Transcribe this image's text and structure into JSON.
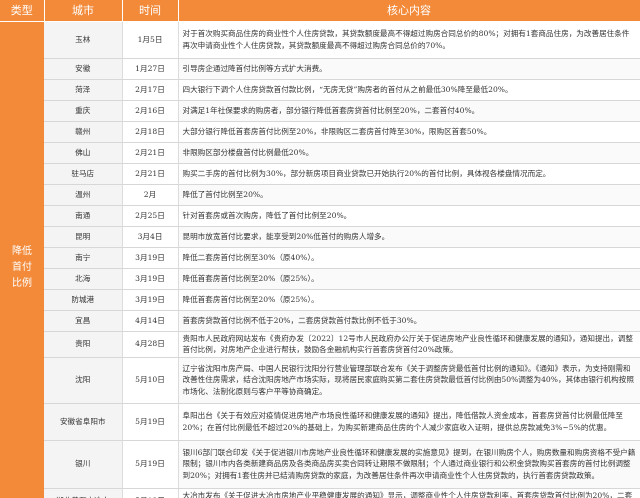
{
  "headers": [
    "类型",
    "城市",
    "时间",
    "核心内容"
  ],
  "type_label": "降低首付比例",
  "rows": [
    {
      "city": "玉林",
      "date": "1月5日",
      "content": "对于首次购买商品住房的商业性个人住房贷款，其贷款额度最高不得超过购房合同总价的80%；对拥有1套商品住房，为改善居住条件再次申请商业性个人住房贷款，其贷款额度最高不得超过购房合同总价的70%。"
    },
    {
      "city": "安徽",
      "date": "1月27日",
      "content": "引导房企通过降首付比例等方式扩大消费。"
    },
    {
      "city": "菏泽",
      "date": "2月17日",
      "content": "四大银行下调个人住房贷款首付款比例，“无房无贷”购房者的首付从之前最低30%降至最低20%。"
    },
    {
      "city": "重庆",
      "date": "2月16日",
      "content": "对满足1年社保要求的购房者，部分银行降低首套房贷首付比例至20%，二套首付40%。"
    },
    {
      "city": "赣州",
      "date": "2月18日",
      "content": "大部分银行降低首套房首付比例至20%，非限购区二套房首付降至30%，限购区首套50%。"
    },
    {
      "city": "佛山",
      "date": "2月21日",
      "content": "非限购区部分楼盘首付比例最低20%。"
    },
    {
      "city": "驻马店",
      "date": "2月21日",
      "content": "购买二手房的首付比例为30%，部分新房项目商业贷款已开始执行20%的首付比例，具体视各楼盘情况而定。"
    },
    {
      "city": "温州",
      "date": "2月",
      "content": "降低了首付比例至20%。"
    },
    {
      "city": "南通",
      "date": "2月25日",
      "content": "针对首套房或首次购房，降低了首付比例至20%。"
    },
    {
      "city": "昆明",
      "date": "3月4日",
      "content": "昆明市放宽首付比要求，能享受到20%低首付的购房人增多。"
    },
    {
      "city": "南宁",
      "date": "3月19日",
      "content": "降低二套房首付比例至30%（原40%）。"
    },
    {
      "city": "北海",
      "date": "3月19日",
      "content": "降低首套房首付比例至20%（原25%）。"
    },
    {
      "city": "防城港",
      "date": "3月19日",
      "content": "降低首套房首付比例至20%（原25%）。"
    },
    {
      "city": "宜昌",
      "date": "4月14日",
      "content": "首套房贷款首付比例不低于20%，二套房贷款首付款比例不低于30%。"
    },
    {
      "city": "贵阳",
      "date": "4月28日",
      "content": "贵阳市人民政府网站发布《贵府办发〔2022〕12号市人民政府办公厅关于促进房地产业良性循环和健康发展的通知》，通知提出，调整首付比例，对房地产企业进行帮扶，鼓励各金融机构实行首套房贷首付20%政策。"
    },
    {
      "city": "沈阳",
      "date": "5月10日",
      "content": "辽宁省沈阳市房产局、中国人民银行沈阳分行营业管理部联合发布《关于调整房贷最低首付比例的通知》。《通知》表示，为支持刚需和改善性住房需求，结合沈阳房地产市场实际，现将居民家庭购买第二套住房贷款最低首付比例由50%调整为40%，其体由银行机构按照市场化、法制化原则与客户平等协商确定。"
    },
    {
      "city": "安徽省阜阳市",
      "date": "5月19日",
      "content": "阜阳出台《关于有效应对疫情促进房地产市场良性循环和健康发展的通知》提出，降低借款人资金成本，首套房贷首付比例最低降至20%；在首付比例最低不超过20%的基础上，为购买新建商品住房的个人减少家庭收入证明，提供总房款减免3%~5%的优惠。"
    },
    {
      "city": "银川",
      "date": "5月19日",
      "content": "银川6部门联合印发《关于促进银川市房地产业良性循环和健康发展的实施意见》提到，在银川购房个人，购房数量和购房资格不受户籍限制；银川市内各类新建商品房及各类商品房买卖合同转让期限不做限制；个人通过商业银行和公积金贷款购买首套房的首付比例调整到20%；对拥有1套住房并已结清购房贷款的家庭，为改善居住条件再次申请商业性个人住房贷款的，执行首套房贷款政策。"
    },
    {
      "city": "湖北黄石大冶市",
      "date": "5月19日",
      "content": "大冶市发布《关于促进大冶市房地产业平稳健康发展的通知》显示，调整商业性个人住房贷款利率，首套房贷款首付比例为20%，二套房贷款最低首付30%。"
    }
  ],
  "colors": {
    "accent": "#f28a3a",
    "row_line": "#d7d7d7"
  }
}
